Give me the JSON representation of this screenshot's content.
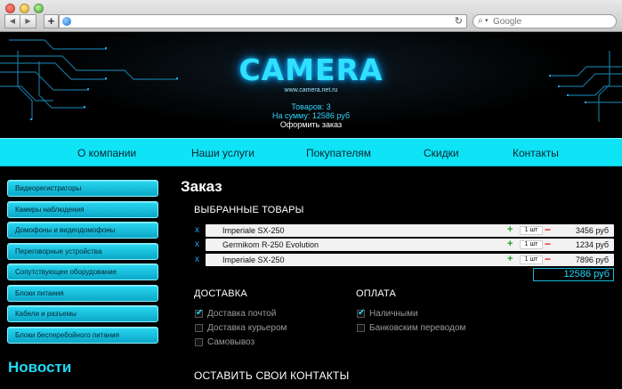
{
  "browser": {
    "search_placeholder": "Google"
  },
  "header": {
    "logo": "CAMERA",
    "site_url": "www.camera.net.ru",
    "cart_count": "Товаров: 3",
    "cart_sum": "На сумму: 12586 руб",
    "checkout": "Оформить заказ"
  },
  "nav": [
    "О компании",
    "Наши услуги",
    "Покупателям",
    "Скидки",
    "Контакты"
  ],
  "sidebar": {
    "items": [
      "Видеорегистраторы",
      "Камеры наблюдения",
      "Домофоны и видеодомофоны",
      "Переговорные устройства",
      "Сопутствующее оборудование",
      "Блоки питания",
      "Кабели и разъемы",
      "Блоки бесперебойного питания"
    ],
    "news_title": "Новости"
  },
  "order": {
    "title": "Заказ",
    "selected_label": "ВЫБРАННЫЕ ТОВАРЫ",
    "remove_symbol": "x",
    "items": [
      {
        "name": "Imperiale SX-250",
        "qty": "1 шт",
        "price": "3456 руб"
      },
      {
        "name": "Germikom R-250 Evolution",
        "qty": "1 шт",
        "price": "1234 руб"
      },
      {
        "name": "Imperiale SX-250",
        "qty": "1 шт",
        "price": "7896 руб"
      }
    ],
    "total": "12586 руб"
  },
  "delivery": {
    "label": "ДОСТАВКА",
    "options": [
      {
        "label": "Доставка почтой",
        "checked": true
      },
      {
        "label": "Доставка курьером",
        "checked": false
      },
      {
        "label": "Самовывоз",
        "checked": false
      }
    ]
  },
  "payment": {
    "label": "ОПЛАТА",
    "options": [
      {
        "label": "Наличными",
        "checked": true
      },
      {
        "label": "Банковским переводом",
        "checked": false
      }
    ]
  },
  "contacts_label": "ОСТАВИТЬ СВОИ КОНТАКТЫ",
  "colors": {
    "accent": "#0fe3f6",
    "logo": "#2fe0ff"
  }
}
